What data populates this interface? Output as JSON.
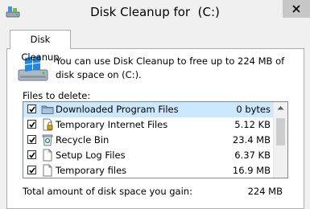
{
  "window": {
    "title": "Disk Cleanup for  (C:)",
    "app_icon": "disk-cleanup-icon",
    "close_icon": "close-icon"
  },
  "tabs": [
    {
      "label": "Disk Cleanup",
      "active": true
    }
  ],
  "info": {
    "icon": "drive-icon",
    "text": "You can use Disk Cleanup to free up to 224 MB of disk space on  (C:)."
  },
  "files": {
    "label": "Files to delete:",
    "items": [
      {
        "checked": true,
        "name": "Downloaded Program Files",
        "size": "0 bytes",
        "icon": "folder-icon",
        "selected": true
      },
      {
        "checked": true,
        "name": "Temporary Internet Files",
        "size": "5.12 KB",
        "icon": "lock-file-icon"
      },
      {
        "checked": true,
        "name": "Recycle Bin",
        "size": "23.4 MB",
        "icon": "recycle-bin-icon"
      },
      {
        "checked": true,
        "name": "Setup Log Files",
        "size": "6.37 KB",
        "icon": "document-icon"
      },
      {
        "checked": true,
        "name": "Temporary files",
        "size": "16.9 MB",
        "icon": "document-icon"
      }
    ]
  },
  "summary": {
    "label": "Total amount of disk space you gain:",
    "value": "224 MB"
  },
  "colors": {
    "selected_row": "#cce8ff",
    "background": "#f0f0f0"
  }
}
